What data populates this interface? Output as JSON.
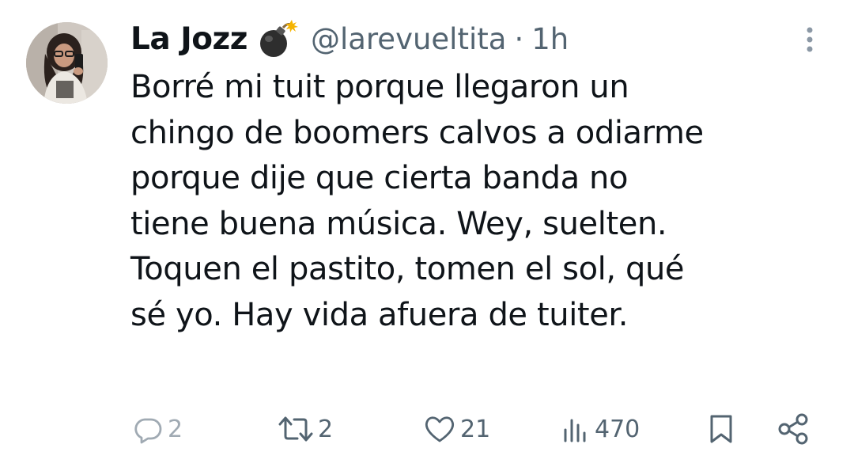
{
  "tweet": {
    "author": {
      "display_name": "La Jozz",
      "handle": "@larevueltita",
      "name_emoji_icon": "bomb-icon"
    },
    "separator": "·",
    "timestamp": "1h",
    "text_lines": [
      "Borré mi tuit porque llegaron un",
      "chingo de boomers calvos a odiarme",
      "porque dije que cierta banda no",
      "tiene buena música. Wey, suelten.",
      "Toquen el pastito, tomen el sol, qué",
      "sé yo. Hay vida afuera de tuiter."
    ],
    "stats": {
      "replies": "2",
      "reposts": "2",
      "likes": "21",
      "views": "470"
    }
  },
  "icons": {
    "reply": "reply-icon",
    "repost": "repost-icon",
    "like": "heart-icon",
    "views": "views-icon",
    "bookmark": "bookmark-icon",
    "share": "share-icon",
    "more": "more-vertical-icon"
  },
  "colors": {
    "text_primary": "#0f1419",
    "text_secondary": "#536471",
    "background": "#ffffff"
  }
}
